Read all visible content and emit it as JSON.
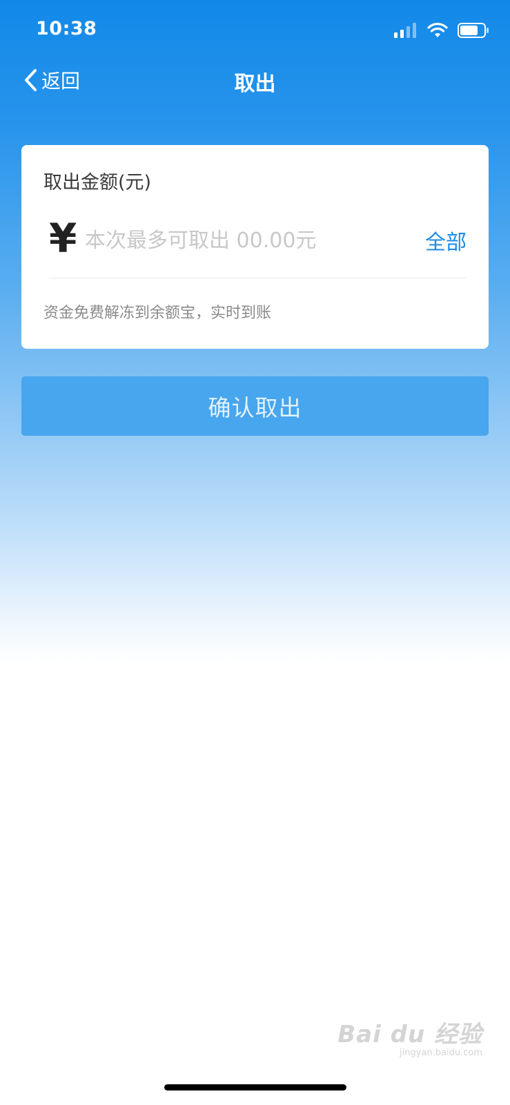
{
  "status_bar": {
    "time": "10:38",
    "icons": [
      "cellular-signal-icon",
      "wifi-icon",
      "battery-icon"
    ]
  },
  "nav": {
    "back_label": "返回",
    "title": "取出"
  },
  "card": {
    "title": "取出金额(元)",
    "currency_symbol": "¥",
    "amount_value": "",
    "amount_placeholder": "本次最多可取出 00.00元",
    "all_label": "全部",
    "note": "资金免费解冻到余额宝，实时到账"
  },
  "confirm_label": "确认取出",
  "watermark": {
    "main": "Bai du 经验",
    "sub": "jingyan.baidu.com"
  },
  "colors": {
    "brand_blue": "#1289e8",
    "link_blue": "#1a8ae6",
    "button_blue": "#47a6ee"
  }
}
